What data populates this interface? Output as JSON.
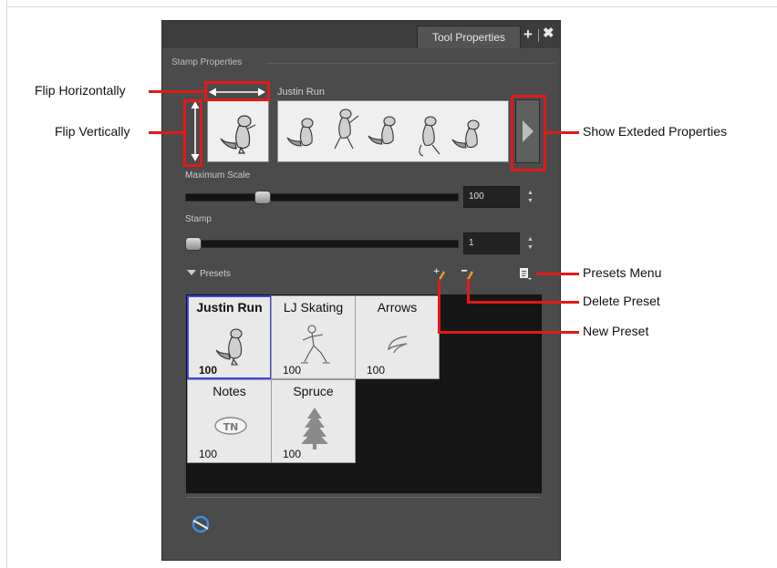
{
  "panel": {
    "tab_label": "Tool Properties",
    "section_title": "Stamp Properties",
    "stamp_name": "Justin Run",
    "maximum_scale": {
      "label": "Maximum Scale",
      "value": "100",
      "fraction": 0.27
    },
    "stamp": {
      "label": "Stamp",
      "value": "1",
      "fraction": 0.0
    },
    "presets_label": "Presets",
    "presets": [
      {
        "name": "Justin Run",
        "value": "100",
        "selected": true,
        "art": "beaver-icon"
      },
      {
        "name": "LJ Skating",
        "value": "100",
        "selected": false,
        "art": "skater-icon"
      },
      {
        "name": "Arrows",
        "value": "100",
        "selected": false,
        "art": "arrow-stroke-icon"
      },
      {
        "name": "Notes",
        "value": "100",
        "selected": false,
        "art": "note-stamp-icon"
      },
      {
        "name": "Spruce",
        "value": "100",
        "selected": false,
        "art": "spruce-tree-icon"
      }
    ]
  },
  "callouts": {
    "flip_horizontally": "Flip Horizontally",
    "flip_vertically": "Flip Vertically",
    "show_extended_properties": "Show Exteded Properties",
    "presets_menu": "Presets Menu",
    "delete_preset": "Delete Preset",
    "new_preset": "New Preset"
  },
  "colors": {
    "callout_red": "#e11a1a",
    "selection_blue": "#3b44f0",
    "panel_bg": "#4b4b4b"
  }
}
